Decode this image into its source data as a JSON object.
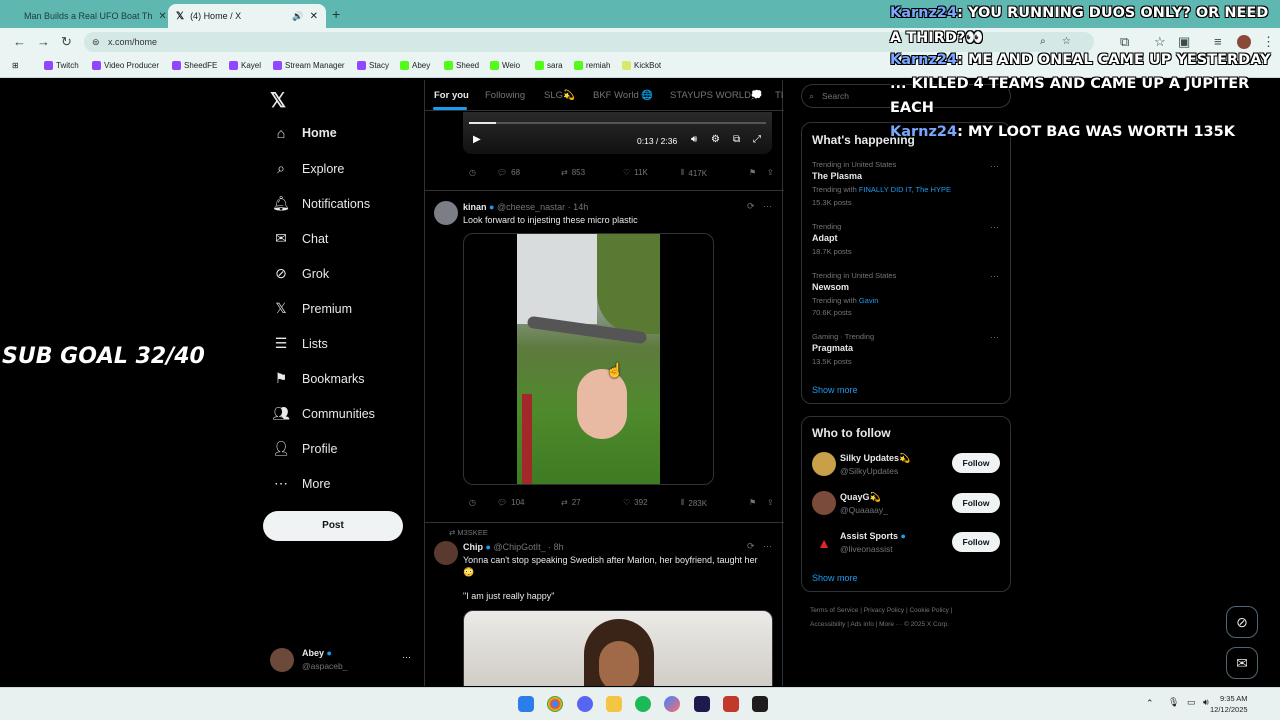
{
  "browser": {
    "tabs": [
      {
        "title": "Man Builds a Real UFO Boat Th",
        "favicon": "youtube-icon"
      },
      {
        "title": "(4) Home / X",
        "favicon": "x-icon"
      }
    ],
    "url": "x.com/home",
    "bookmarks": [
      "Twitch",
      "Video Producer",
      "SheedFE",
      "Kayel",
      "Stream Manager",
      "Stacy",
      "Abey",
      "Sheed",
      "Weio",
      "sara",
      "remiah",
      "KickBot"
    ]
  },
  "sidebar": {
    "items": [
      {
        "label": "Home",
        "icon": "home-icon"
      },
      {
        "label": "Explore",
        "icon": "search-icon"
      },
      {
        "label": "Notifications",
        "icon": "bell-icon"
      },
      {
        "label": "Chat",
        "icon": "mail-icon"
      },
      {
        "label": "Grok",
        "icon": "grok-icon"
      },
      {
        "label": "Premium",
        "icon": "x-icon"
      },
      {
        "label": "Lists",
        "icon": "list-icon"
      },
      {
        "label": "Bookmarks",
        "icon": "bookmark-icon"
      },
      {
        "label": "Communities",
        "icon": "people-icon"
      },
      {
        "label": "Profile",
        "icon": "person-icon"
      },
      {
        "label": "More",
        "icon": "more-icon"
      }
    ],
    "post_label": "Post",
    "account": {
      "name": "Abey",
      "handle": "@aspaceb_"
    }
  },
  "feed": {
    "tabs": [
      "For you",
      "Following",
      "SLG💫",
      "BKF World 🌐",
      "STAYUPS WORLD💭",
      "TI"
    ],
    "video_time": "0:13 / 2:36",
    "post0_stats": {
      "replies": "68",
      "reposts": "853",
      "likes": "11K",
      "views": "417K"
    },
    "post1": {
      "name": "kinan",
      "handle": "@cheese_nastar",
      "time": "· 14h",
      "text": "Look forward to injesting these micro plastic",
      "stats": {
        "replies": "104",
        "reposts": "27",
        "likes": "392",
        "views": "283K"
      }
    },
    "post2": {
      "social_context": "M3SKEE",
      "name": "Chip",
      "handle": "@ChipGotIt_",
      "time": "· 8h",
      "text": "Yonna can't stop speaking Swedish after Marlon, her boyfriend, taught her",
      "emoji": "😳",
      "quote": "\"I am just really happy\""
    }
  },
  "right": {
    "search_placeholder": "Search",
    "happening_title": "What's happening",
    "trends": [
      {
        "context": "Trending in United States",
        "name": "The Plasma",
        "extra_prefix": "Trending with ",
        "extra_links": "FINALLY DID IT, The HYPE",
        "posts": "15.3K posts"
      },
      {
        "context": "Trending",
        "name": "Adapt",
        "extra_prefix": "",
        "extra_links": "",
        "posts": "18.7K posts"
      },
      {
        "context": "Trending in United States",
        "name": "Newsom",
        "extra_prefix": "Trending with ",
        "extra_links": "Gavin",
        "posts": "70.6K posts"
      },
      {
        "context": "Gaming · Trending",
        "name": "Pragmata",
        "extra_prefix": "",
        "extra_links": "",
        "posts": "13.5K posts"
      }
    ],
    "show_more": "Show more",
    "follow_title": "Who to follow",
    "follow": [
      {
        "name": "Silky Updates💫",
        "handle": "@SilkyUpdates",
        "button": "Follow"
      },
      {
        "name": "QuayG💫",
        "handle": "@Quaaaay_",
        "button": "Follow"
      },
      {
        "name": "Assist Sports",
        "handle": "@liveonassist",
        "button": "Follow"
      }
    ],
    "footer_line1": "Terms of Service  |  Privacy Policy  |  Cookie Policy  |",
    "footer_line2": "Accessibility  |  Ads info  |  More ···  © 2025 X Corp."
  },
  "overlay": {
    "sub_goal": "SUB GOAL 32/40",
    "chat": [
      {
        "user": "Karnz24",
        "line1": ": YOU RUNNING DUOS ONLY? OR NEED",
        "line2": "A THIRD?👀"
      },
      {
        "user": "Karnz24",
        "line1": ": ME AND ONEAL CAME UP YESTERDAY",
        "line2": "... KILLED 4 TEAMS AND CAME UP A JUPITER",
        "line3": "EACH"
      },
      {
        "user": "Karnz24",
        "line1": ": MY LOOT BAG WAS WORTH 135K"
      }
    ]
  },
  "taskbar": {
    "time": "9:35 AM",
    "date": "12/12/2025"
  }
}
